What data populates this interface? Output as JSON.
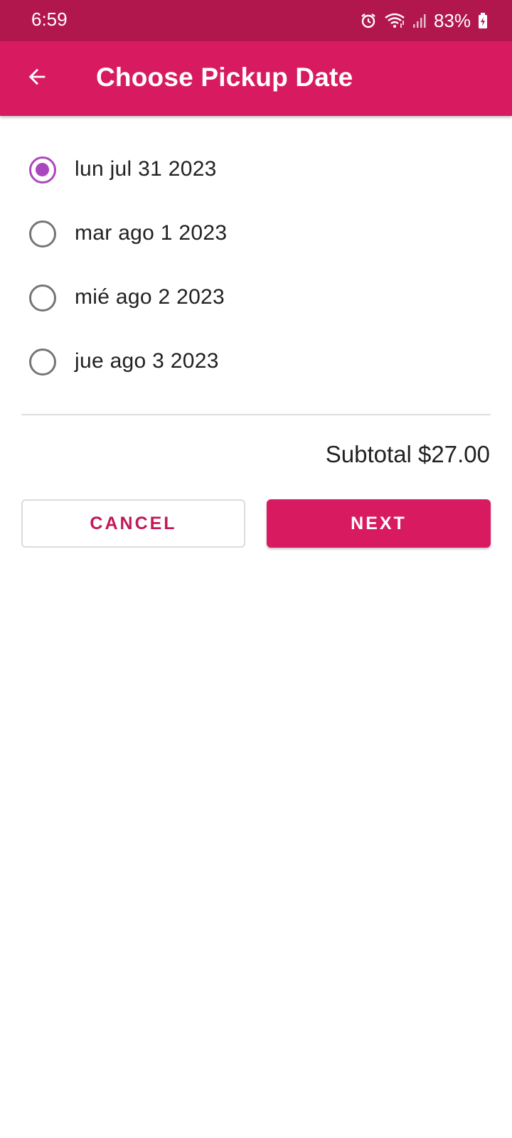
{
  "status_bar": {
    "time": "6:59",
    "battery_percent": "83%",
    "icons": [
      "alarm-icon",
      "wifi-icon",
      "signal-icon",
      "battery-charging-icon"
    ]
  },
  "app_bar": {
    "title": "Choose Pickup Date",
    "back_icon": "arrow-back-icon",
    "background_color": "#d81b60"
  },
  "pickup_dates": {
    "options": [
      {
        "label": "lun jul 31 2023",
        "selected": true
      },
      {
        "label": "mar ago 1 2023",
        "selected": false
      },
      {
        "label": "mié ago 2 2023",
        "selected": false
      },
      {
        "label": "jue ago 3 2023",
        "selected": false
      }
    ],
    "selected_color": "#ab47bc"
  },
  "summary": {
    "subtotal": "Subtotal $27.00"
  },
  "actions": {
    "cancel_label": "CANCEL",
    "next_label": "NEXT",
    "accent_color": "#d81b60"
  }
}
